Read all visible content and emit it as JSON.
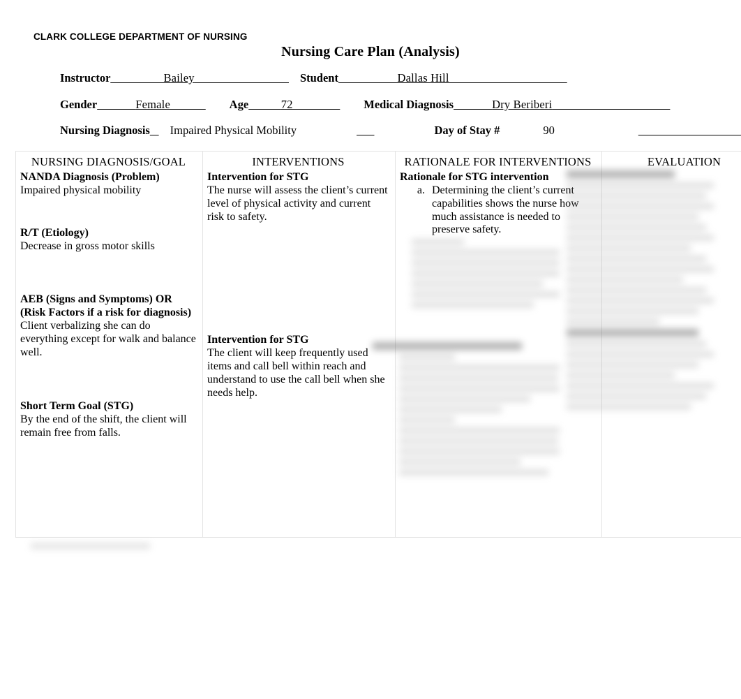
{
  "document": {
    "organization": "CLARK COLLEGE DEPARTMENT OF NURSING",
    "title": "Nursing Care Plan (Analysis)"
  },
  "header_fields": {
    "instructor_label": "Instructor",
    "instructor_value": "Bailey",
    "student_label": "Student",
    "student_value": "Dallas Hill",
    "gender_label": "Gender",
    "gender_value": "Female",
    "age_label": "Age",
    "age_value": "72",
    "medical_diagnosis_label": "Medical Diagnosis",
    "medical_diagnosis_value": "Dry Beriberi",
    "nursing_diagnosis_label": "Nursing Diagnosis",
    "nursing_diagnosis_value": "Impaired Physical Mobility",
    "day_of_stay_label": "Day of Stay #",
    "day_of_stay_value": "90"
  },
  "table": {
    "headers": [
      "NURSING DIAGNOSIS/GOAL",
      "INTERVENTIONS",
      "RATIONALE FOR INTERVENTIONS",
      "EVALUATION"
    ],
    "column1": {
      "nanda_heading": "NANDA Diagnosis (Problem)",
      "nanda_text": "Impaired physical mobility",
      "rt_heading": "R/T (Etiology)",
      "rt_text": "Decrease in gross motor skills",
      "aeb_heading": "AEB (Signs and Symptoms) OR (Risk Factors if a risk for diagnosis)",
      "aeb_text": "Client verbalizing she can do everything except for walk and balance well.",
      "stg_heading": "Short Term Goal (STG)",
      "stg_text": "By the end of the shift, the client will remain free from falls."
    },
    "column2": {
      "intervention1_heading": "Intervention for STG",
      "intervention1_text": "The nurse will assess the client’s current level of physical activity and current risk to safety.",
      "intervention2_heading": "Intervention for STG",
      "intervention2_text": "The client will keep frequently used items and call bell within reach and understand to use the call bell when she needs help."
    },
    "column3": {
      "rationale1_heading": "Rationale for STG intervention",
      "rationale1_items": [
        "Determining the client’s current capabilities shows the nurse how much assistance is needed to preserve safety."
      ]
    }
  }
}
